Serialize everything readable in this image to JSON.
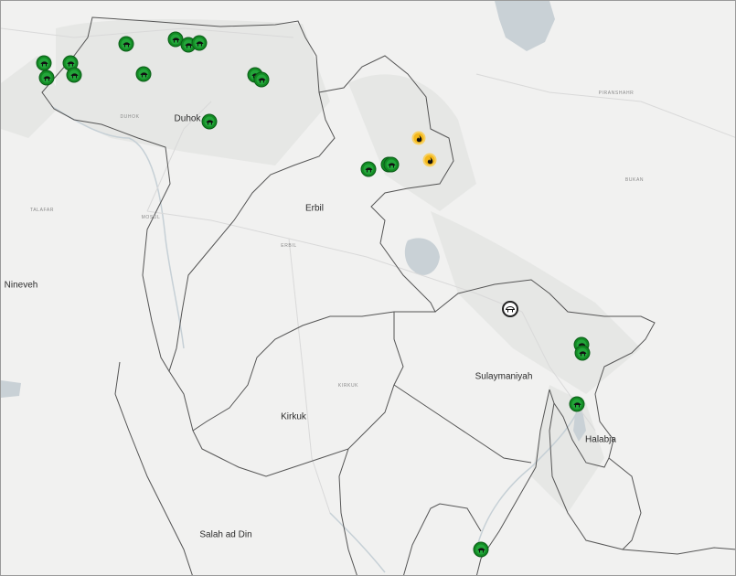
{
  "labels": {
    "region_labels": [
      {
        "id": "duhok",
        "text": "Duhok"
      },
      {
        "id": "erbil",
        "text": "Erbil"
      },
      {
        "id": "nineveh",
        "text": "Nineveh"
      },
      {
        "id": "kirkuk",
        "text": "Kirkuk"
      },
      {
        "id": "sulaymaniyah",
        "text": "Sulaymaniyah"
      },
      {
        "id": "halabja",
        "text": "Halabja"
      },
      {
        "id": "salah-ad-din",
        "text": "Salah ad Din"
      }
    ],
    "city_labels": [
      {
        "id": "mosul",
        "text": "MOSUL"
      },
      {
        "id": "duhok-city",
        "text": "DUHOK"
      },
      {
        "id": "erbil-city",
        "text": "ERBIL"
      },
      {
        "id": "kirkuk-city",
        "text": "KIRKUK"
      },
      {
        "id": "talafar",
        "text": "TALAFAR"
      },
      {
        "id": "piranshahr",
        "text": "PIRANSHAHR"
      },
      {
        "id": "bukan",
        "text": "BUKAN"
      }
    ]
  },
  "markers": [
    {
      "id": "m1",
      "type": "green",
      "icon": "shelter-icon"
    },
    {
      "id": "m2",
      "type": "green",
      "icon": "shelter-icon"
    },
    {
      "id": "m3",
      "type": "green",
      "icon": "shelter-icon"
    },
    {
      "id": "m4",
      "type": "green",
      "icon": "shelter-icon"
    },
    {
      "id": "m5",
      "type": "green",
      "icon": "shelter-icon"
    },
    {
      "id": "m6",
      "type": "green",
      "icon": "shelter-icon"
    },
    {
      "id": "m7",
      "type": "green",
      "icon": "shelter-icon"
    },
    {
      "id": "m8",
      "type": "green",
      "icon": "shelter-icon"
    },
    {
      "id": "m9",
      "type": "green",
      "icon": "shelter-icon"
    },
    {
      "id": "m10",
      "type": "green",
      "icon": "shelter-icon"
    },
    {
      "id": "m11",
      "type": "green",
      "icon": "shelter-icon"
    },
    {
      "id": "m12",
      "type": "green",
      "icon": "shelter-icon"
    },
    {
      "id": "m13",
      "type": "green",
      "icon": "shelter-icon"
    },
    {
      "id": "m14",
      "type": "green",
      "icon": "shelter-icon"
    },
    {
      "id": "m15",
      "type": "green",
      "icon": "shelter-icon"
    },
    {
      "id": "m16",
      "type": "yellow",
      "icon": "flame-icon"
    },
    {
      "id": "m17",
      "type": "yellow",
      "icon": "flame-icon"
    },
    {
      "id": "m18",
      "type": "outline",
      "icon": "shelter-icon"
    },
    {
      "id": "m19",
      "type": "green",
      "icon": "shelter-icon"
    },
    {
      "id": "m20",
      "type": "green",
      "icon": "shelter-icon"
    },
    {
      "id": "m21",
      "type": "green",
      "icon": "shelter-icon"
    },
    {
      "id": "m22",
      "type": "green",
      "icon": "shelter-icon"
    }
  ],
  "colors": {
    "green": "#23a53a",
    "yellow": "#f4b81a",
    "border": "#555555",
    "lake": "#c9d1d6"
  }
}
